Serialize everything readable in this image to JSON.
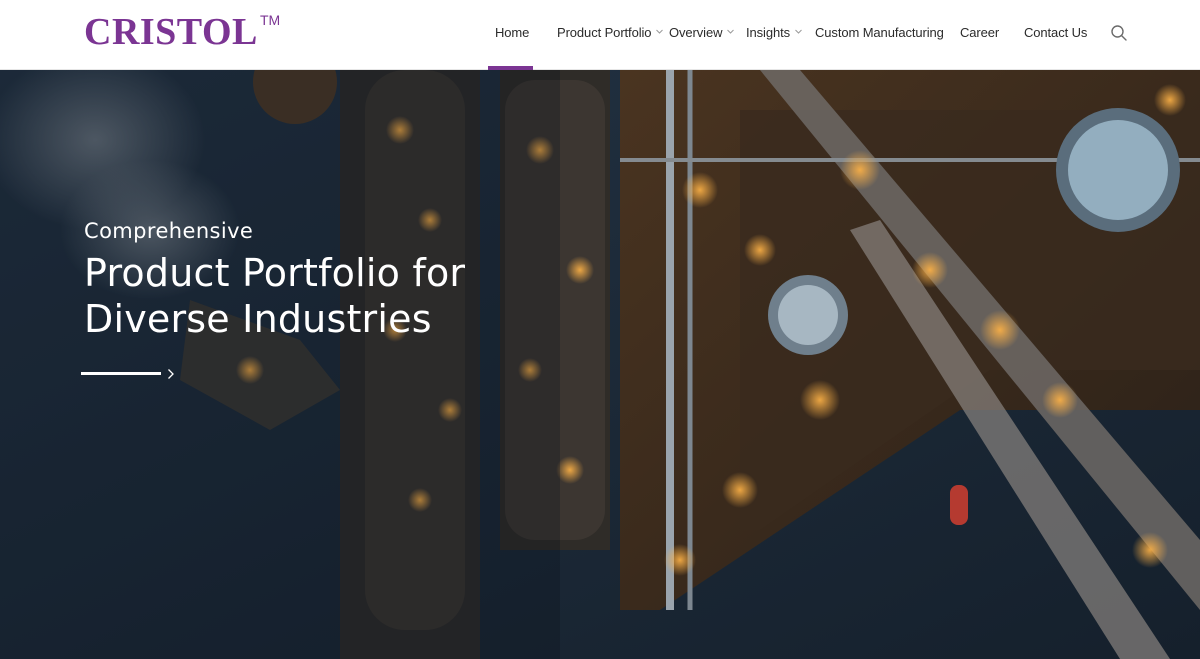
{
  "brand": {
    "name": "CRISTOL",
    "trademark": "TM"
  },
  "nav": {
    "items": [
      {
        "id": "home",
        "label": "Home",
        "has_dropdown": false,
        "active": true
      },
      {
        "id": "portfolio",
        "label": "Product Portfolio",
        "has_dropdown": true
      },
      {
        "id": "overview",
        "label": "Overview",
        "has_dropdown": true
      },
      {
        "id": "insights",
        "label": "Insights",
        "has_dropdown": true
      },
      {
        "id": "custom",
        "label": "Custom Manufacturing",
        "has_dropdown": false
      },
      {
        "id": "career",
        "label": "Career",
        "has_dropdown": false
      },
      {
        "id": "contact",
        "label": "Contact Us",
        "has_dropdown": false
      }
    ],
    "search_icon": "search-icon"
  },
  "hero": {
    "kicker": "Comprehensive",
    "title": "Product Portfolio for Diverse Industries",
    "cta_icon": "chevron-right-icon"
  },
  "colors": {
    "brand": "#7b3593",
    "nav_text": "#2b2b2b",
    "hero_text": "#ffffff",
    "hero_background": "#1b2735"
  }
}
